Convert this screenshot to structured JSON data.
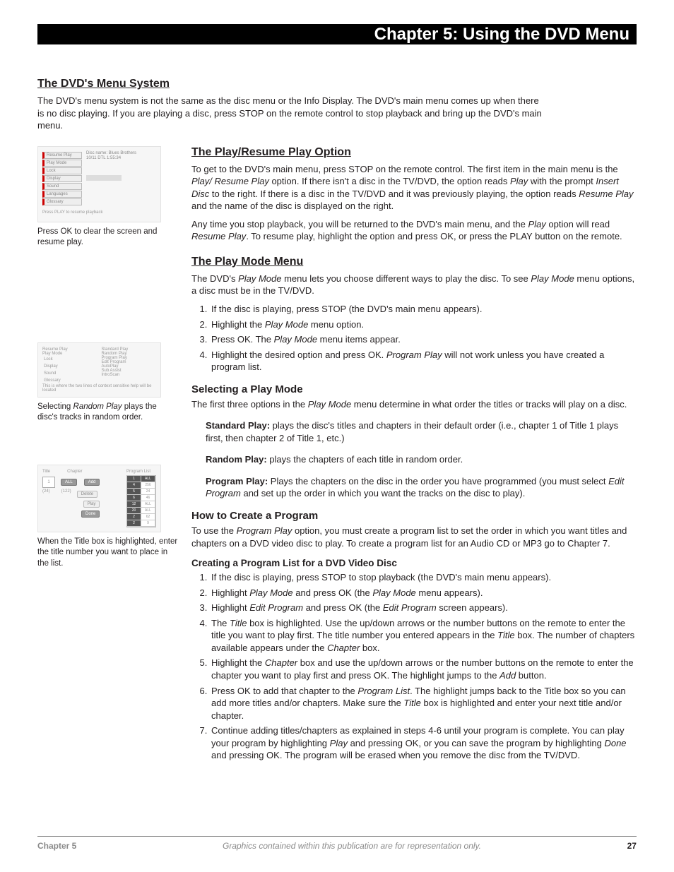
{
  "header": {
    "title": "Chapter 5: Using the DVD Menu"
  },
  "intro": {
    "heading": "The DVD's Menu System",
    "para": "The DVD's menu system is not the same as the disc menu or the Info Display. The DVD's main menu comes up when there is no disc playing. If you are playing a disc, press STOP on the remote control to stop playback and bring up the DVD's main menu."
  },
  "mock1": {
    "items": [
      "Resume Play",
      "Play Mode",
      "Lock",
      "Display",
      "Sound",
      "Languages",
      "Glossary"
    ],
    "disc_label": "Disc name: Blues Brothers",
    "disc_time": "10/11 DTL  1:55:34",
    "help": "Press PLAY to resume playback",
    "caption": "Press OK to clear the screen and resume play."
  },
  "playresume": {
    "heading": "The Play/Resume Play Option",
    "p1a": "To get to the DVD's main menu, press STOP on the remote control. The first item in the main menu is the ",
    "p1b": " option. If there isn't a disc in the TV/DVD, the option reads ",
    "p1c": " with the prompt ",
    "p1d": " to the right. If there is a disc in the TV/DVD and it was previously playing, the option reads ",
    "p1e": " and the name of the disc is displayed on the right.",
    "i_playresume": "Play/ Resume Play",
    "i_play": "Play",
    "i_insert": "Insert Disc",
    "i_resume": "Resume Play",
    "p2a": "Any time you stop playback, you will be returned to the DVD's main menu, and the ",
    "p2b": " option will read ",
    "p2c": ". To resume play, highlight the option and press OK, or press the PLAY button on the remote."
  },
  "playmode": {
    "heading": "The Play Mode Menu",
    "p1a": "The DVD's ",
    "p1b": " menu lets you choose different ways to play the disc. To see ",
    "p1c": " menu options, a disc must be in the TV/DVD.",
    "i_pm": "Play Mode",
    "steps": [
      "If the disc is playing, press STOP (the DVD's main menu appears).",
      "Highlight the Play Mode menu option.",
      "Press OK. The Play Mode menu items appear.",
      "Highlight the desired option and press OK. Program Play will not work unless you have created a program list."
    ]
  },
  "mock2": {
    "left": [
      "Resume Play",
      "Play Mode",
      "Lock",
      "Display",
      "Sound",
      "Glossary"
    ],
    "right": [
      "Standard Play",
      "Random Play",
      "Program Play",
      "Edit Program",
      "AutoPlay",
      "Sub Assist",
      "IntroScan"
    ],
    "help": "This is where the two lines of context sensitive help will be located",
    "caption_a": "Selecting ",
    "caption_i": "Random Play",
    "caption_b": " plays the disc's tracks in random order."
  },
  "selecting": {
    "heading": "Selecting a Play Mode",
    "lead_a": "The first three options in the ",
    "lead_b": " menu determine in what order the titles or tracks will play on a disc.",
    "i_pm": "Play Mode",
    "std_t": "Standard Play:",
    "std_b": " plays the disc's titles and chapters in their default order (i.e., chapter 1 of Title 1 plays first, then chapter 2 of Title 1, etc.)",
    "rnd_t": "Random Play:",
    "rnd_b": " plays the chapters of each title in random order.",
    "prg_t": "Program Play:",
    "prg_b1": "  Plays the chapters on the disc in the order you have programmed (you must select ",
    "prg_i": "Edit Program",
    "prg_b2": " and set up the order in which you want the tracks on the disc to play)."
  },
  "howto": {
    "heading": "How to Create a Program",
    "lead_a": "To use the ",
    "lead_i": "Program Play",
    "lead_b": " option, you must create a program list to set the order in which you want titles and chapters on a DVD video disc to play. To create a program list for an Audio CD or MP3 go to Chapter 7.",
    "sub": "Creating a Program List for a DVD Video Disc",
    "steps": [
      {
        "t": "If the disc is playing, press STOP to stop playback (the DVD's main menu appears)."
      },
      {
        "pre": "Highlight ",
        "i1": "Play Mode",
        "mid": " and press OK (the ",
        "i2": "Play Mode",
        "post": " menu appears)."
      },
      {
        "pre": "Highlight ",
        "i1": "Edit Program",
        "mid": " and press OK (the ",
        "i2": "Edit Program",
        "post": " screen appears)."
      },
      {
        "pre": "The ",
        "i1": "Title",
        "mid": " box is highlighted. Use the up/down arrows or the number buttons on the remote to enter the title you want to play first. The title number you entered appears in the ",
        "i2": "Title",
        "mid2": " box. The number of chapters available appears under the ",
        "i3": "Chapter",
        "post": " box."
      },
      {
        "pre": "Highlight the ",
        "i1": "Chapter",
        "mid": " box and use the up/down arrows or the number buttons on the remote to enter the chapter you want to play first and press OK. The highlight jumps to the ",
        "i2": "Add",
        "post": " button."
      },
      {
        "pre": "Press OK to add that chapter to the ",
        "i1": "Program List",
        "mid": ". The highlight jumps back to the Title box so you can add more titles and/or chapters. Make sure the ",
        "i2": "Title",
        "post": " box is highlighted and enter your next title and/or chapter."
      },
      {
        "pre": "Continue adding titles/chapters as explained in steps 4-6 until your program is complete. You can play your program by highlighting ",
        "i1": "Play",
        "mid": " and pressing OK, or you can save the program by highlighting ",
        "i2": "Done",
        "post": " and pressing OK. The program will be erased when you remove the disc from the TV/DVD."
      }
    ]
  },
  "mock3": {
    "hdr_title": "Title",
    "hdr_chap": "Chapter",
    "hdr_prog": "Program List",
    "numbox": "1",
    "all": "ALL",
    "add": "Add",
    "del": "Delete",
    "play": "Play",
    "done": "Done",
    "t1": "(24)",
    "t2": "(122)",
    "caption": "When the Title box is highlighted, enter the title number you want to place in the list."
  },
  "footer": {
    "left": "Chapter 5",
    "center": "Graphics contained within this publication are for representation only.",
    "right": "27"
  }
}
